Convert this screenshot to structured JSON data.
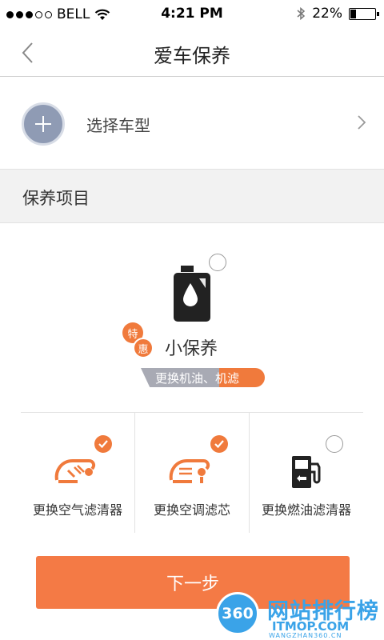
{
  "status_bar": {
    "carrier": "BELL",
    "time": "4:21 PM",
    "battery": "22%",
    "battery_level": 0.22
  },
  "nav": {
    "title": "爱车保养"
  },
  "car": {
    "label": "选择车型"
  },
  "section": {
    "title": "保养项目"
  },
  "main_package": {
    "name": "小保养",
    "badge_special": "特",
    "badge_discount": "惠",
    "ribbon_left": "更换机油、",
    "ribbon_right": "机滤",
    "selected": false
  },
  "sub_items": [
    {
      "label": "更换空气滤清器",
      "icon": "air-filter-icon",
      "selected": true
    },
    {
      "label": "更换空调滤芯",
      "icon": "ac-filter-icon",
      "selected": true
    },
    {
      "label": "更换燃油滤清器",
      "icon": "fuel-pump-icon",
      "selected": false
    }
  ],
  "next_button": {
    "label": "下一步"
  },
  "watermark": {
    "logo": "360",
    "name": "网站排行榜",
    "domain": "ITMOP.COM",
    "sub": "WANGZHAN360.CN"
  },
  "colors": {
    "accent": "#f07a3c",
    "button": "#f47a45",
    "plus_circle": "#8f9bb4",
    "ribbon_gray": "#a8aab4"
  }
}
